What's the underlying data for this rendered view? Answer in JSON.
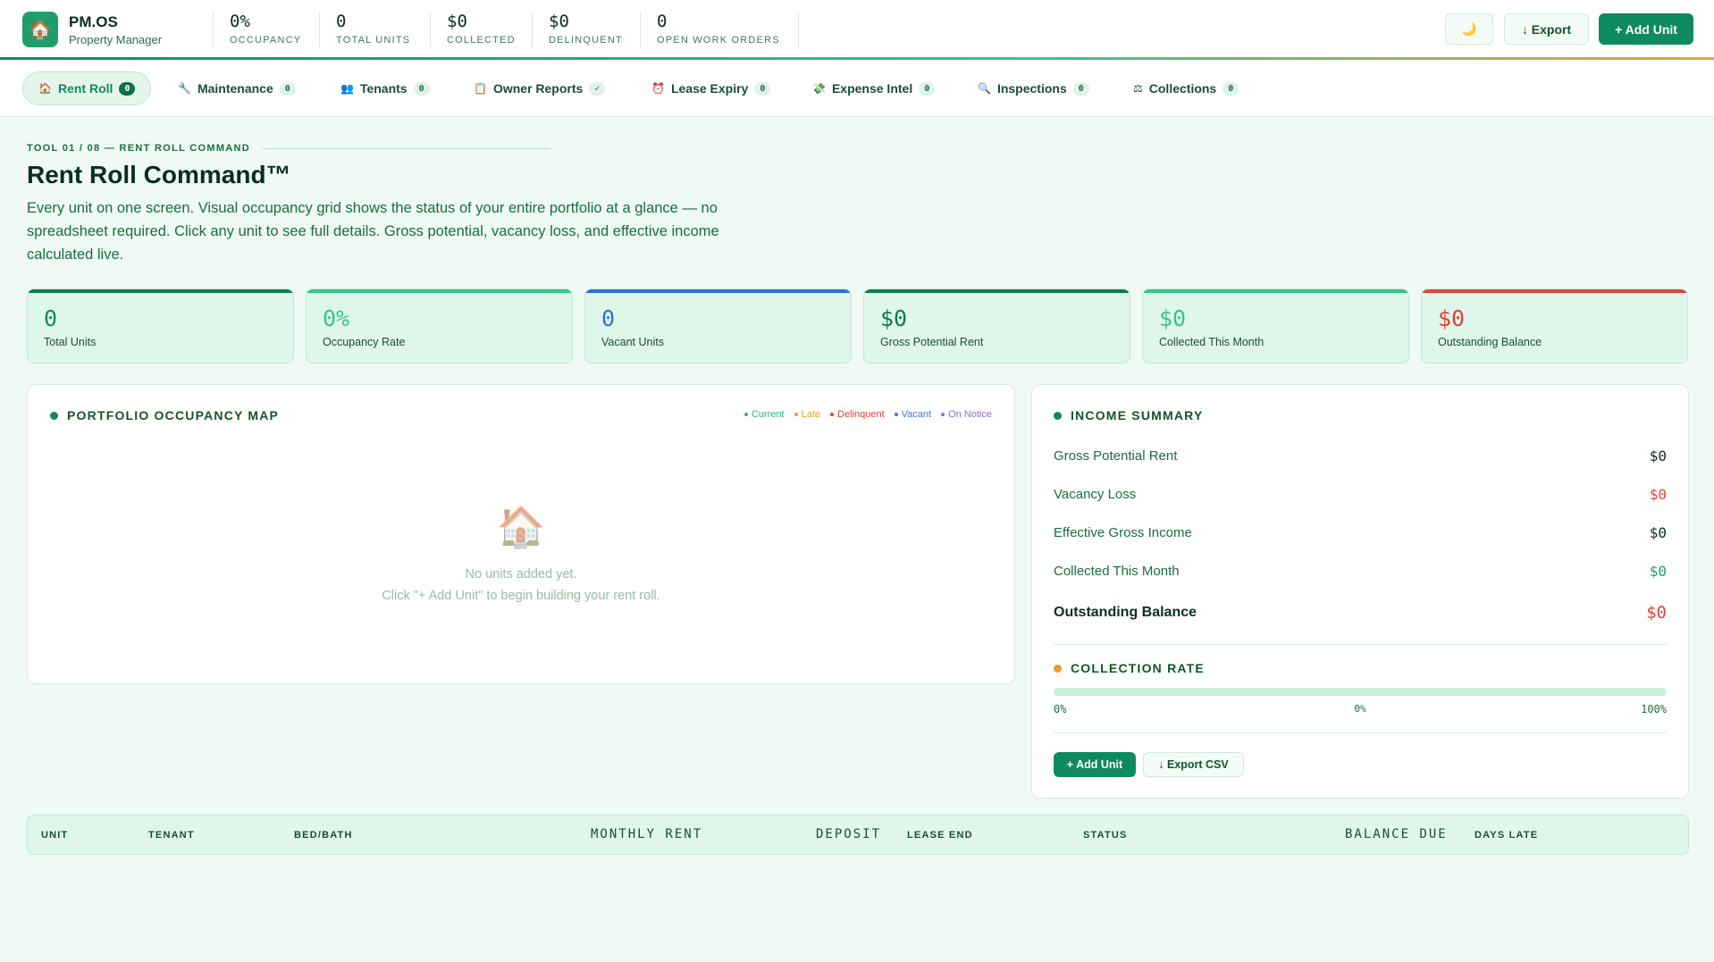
{
  "app": {
    "name": "PM.OS",
    "subtitle": "Property Manager"
  },
  "header_stats": [
    {
      "value": "0%",
      "label": "OCCUPANCY"
    },
    {
      "value": "0",
      "label": "TOTAL UNITS"
    },
    {
      "value": "$0",
      "label": "COLLECTED"
    },
    {
      "value": "$0",
      "label": "DELINQUENT"
    },
    {
      "value": "0",
      "label": "OPEN WORK ORDERS"
    }
  ],
  "header_buttons": {
    "theme_icon": "🌙",
    "export": "↓ Export",
    "add_unit": "+ Add Unit"
  },
  "tabs": [
    {
      "icon": "🏠",
      "label": "Rent Roll",
      "count": "0",
      "icon_name": "house-icon"
    },
    {
      "icon": "🔧",
      "label": "Maintenance",
      "count": "0",
      "icon_name": "wrench-icon"
    },
    {
      "icon": "👥",
      "label": "Tenants",
      "count": "0",
      "icon_name": "people-icon"
    },
    {
      "icon": "📋",
      "label": "Owner Reports",
      "count": "✓",
      "icon_name": "clipboard-icon"
    },
    {
      "icon": "⏰",
      "label": "Lease Expiry",
      "count": "0",
      "icon_name": "alarm-clock-icon"
    },
    {
      "icon": "💸",
      "label": "Expense Intel",
      "count": "0",
      "icon_name": "money-icon"
    },
    {
      "icon": "🔍",
      "label": "Inspections",
      "count": "0",
      "icon_name": "magnifier-icon"
    },
    {
      "icon": "⚖",
      "label": "Collections",
      "count": "0",
      "icon_name": "scales-icon"
    }
  ],
  "intro": {
    "eyebrow": "TOOL 01 / 08 — RENT ROLL COMMAND",
    "title": "Rent Roll Command™",
    "description": "Every unit on one screen. Visual occupancy grid shows the status of your entire portfolio at a glance — no spreadsheet required. Click any unit to see full details. Gross potential, vacancy loss, and effective income calculated live."
  },
  "kpis": [
    {
      "value": "0",
      "label": "Total Units",
      "color": "#0f8a5f",
      "bar": "#0f7a52"
    },
    {
      "value": "0%",
      "label": "Occupancy Rate",
      "color": "#35c48a",
      "bar": "#35c48a"
    },
    {
      "value": "0",
      "label": "Vacant Units",
      "color": "#2f6fdb",
      "bar": "#2f6fdb"
    },
    {
      "value": "$0",
      "label": "Gross Potential Rent",
      "color": "#0f7a52",
      "bar": "#0f7a52"
    },
    {
      "value": "$0",
      "label": "Collected This Month",
      "color": "#35c48a",
      "bar": "#35c48a"
    },
    {
      "value": "$0",
      "label": "Outstanding Balance",
      "color": "#e0433a",
      "bar": "#e0433a"
    }
  ],
  "occupancy_map": {
    "title": "PORTFOLIO OCCUPANCY MAP",
    "legend": [
      {
        "label": "Current",
        "color": "#2fb37a"
      },
      {
        "label": "Late",
        "color": "#e99a2c"
      },
      {
        "label": "Delinquent",
        "color": "#d9463b"
      },
      {
        "label": "Vacant",
        "color": "#4a78d6"
      },
      {
        "label": "On Notice",
        "color": "#8b6fd6"
      }
    ],
    "empty_icon": "🏠",
    "empty_title": "No units added yet.",
    "empty_hint": "Click \"+ Add Unit\" to begin building your rent roll."
  },
  "income_summary": {
    "title": "INCOME SUMMARY",
    "rows": [
      {
        "label": "Gross Potential Rent",
        "value": "$0",
        "color": "#0b2e1e"
      },
      {
        "label": "Vacancy Loss",
        "value": "$0",
        "color": "#e0433a"
      },
      {
        "label": "Effective Gross Income",
        "value": "$0",
        "color": "#0b2e1e"
      },
      {
        "label": "Collected This Month",
        "value": "$0",
        "color": "#1f9e6c"
      }
    ],
    "outstanding": {
      "label": "Outstanding Balance",
      "value": "$0",
      "color": "#e0433a"
    },
    "collection_title": "COLLECTION RATE",
    "collection_rate": 0,
    "scale": {
      "min": "0%",
      "current": "0%",
      "max": "100%"
    },
    "buttons": {
      "add_unit": "+ Add Unit",
      "export_csv": "↓ Export CSV"
    }
  },
  "table": {
    "headers": [
      "UNIT",
      "TENANT",
      "BED/BATH",
      "MONTHLY RENT",
      "DEPOSIT",
      "LEASE END",
      "STATUS",
      "BALANCE DUE",
      "DAYS LATE"
    ]
  }
}
